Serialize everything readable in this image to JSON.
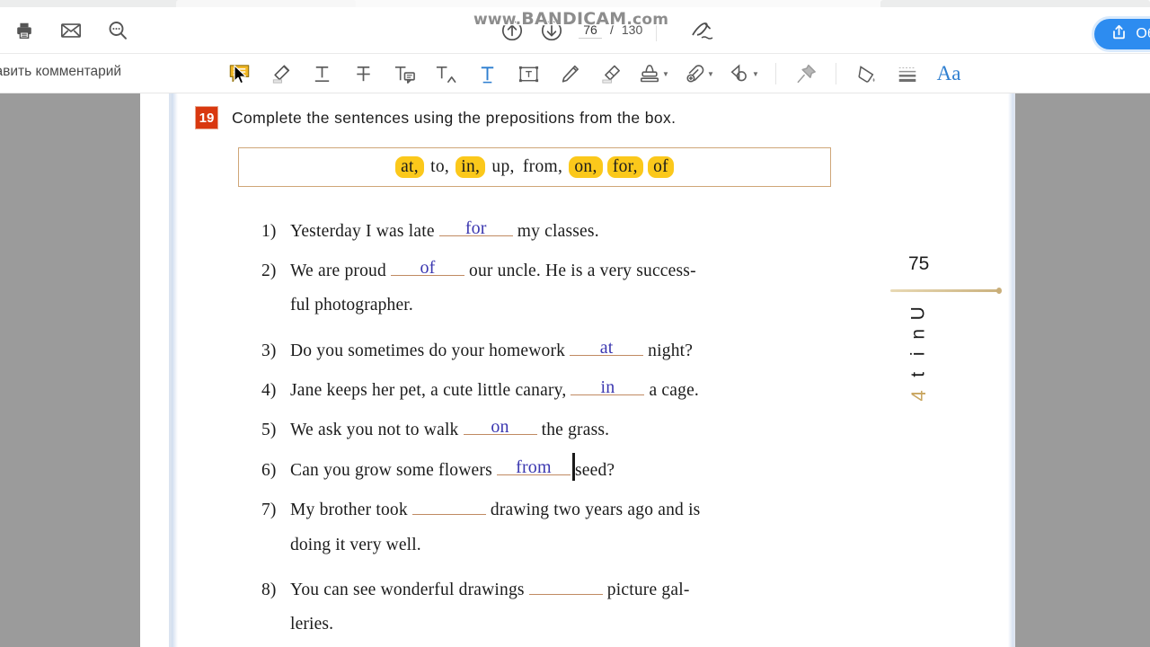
{
  "app": {
    "watermark": "www.BANDICAM.com",
    "watermark_prefix": "www.",
    "watermark_mid": "BANDICAM",
    "watermark_suffix": ".com"
  },
  "toolbar_top": {
    "print_icon": "printer-icon",
    "mail_icon": "envelope-icon",
    "search_icon": "search-comments-icon",
    "prev_page_icon": "arrow-up-circle-icon",
    "next_page_icon": "arrow-down-circle-icon",
    "current_page": "76",
    "page_separator": "/",
    "total_pages": "130",
    "sign_icon": "sign-pen-icon",
    "share_label": "Об",
    "share_icon": "share-upload-icon",
    "share_color": "#2d8cf0"
  },
  "toolbar_tools": {
    "add_comment_label": "бавить комментарий",
    "items": [
      {
        "name": "sticky-note-icon",
        "label": "Заметка"
      },
      {
        "name": "highlighter-icon",
        "label": "Выделение цветом"
      },
      {
        "name": "underline-text-icon",
        "label": "Подчёркивание"
      },
      {
        "name": "strikethrough-text-icon",
        "label": "Зачёркивание"
      },
      {
        "name": "text-comment-icon",
        "label": "Комментарий к тексту"
      },
      {
        "name": "insert-text-icon",
        "label": "Вставка текста"
      },
      {
        "name": "text-tool-icon",
        "label": "Текст"
      },
      {
        "name": "text-box-icon",
        "label": "Текстовое поле"
      },
      {
        "name": "pencil-icon",
        "label": "Карандаш"
      },
      {
        "name": "eraser-icon",
        "label": "Ластик"
      },
      {
        "name": "stamp-icon",
        "label": "Штамп"
      },
      {
        "name": "attachment-icon",
        "label": "Вложение"
      },
      {
        "name": "shapes-icon",
        "label": "Фигуры"
      },
      {
        "name": "pin-icon",
        "label": "Закрепить"
      },
      {
        "name": "fill-color-icon",
        "label": "Заливка"
      },
      {
        "name": "line-style-icon",
        "label": "Толщина линии"
      },
      {
        "name": "font-size-icon",
        "label": "Aa"
      }
    ]
  },
  "document": {
    "exercise_number": "19",
    "exercise_title": "Complete the sentences using the prepositions from the box.",
    "word_box": [
      {
        "text": "at,",
        "highlighted": true
      },
      {
        "text": "to,",
        "highlighted": false
      },
      {
        "text": "in,",
        "highlighted": true
      },
      {
        "text": "up,",
        "highlighted": false
      },
      {
        "text": "from,",
        "highlighted": false
      },
      {
        "text": "on,",
        "highlighted": true
      },
      {
        "text": "for,",
        "highlighted": true
      },
      {
        "text": "of",
        "highlighted": true
      }
    ],
    "sentences": [
      {
        "index": "1)",
        "before": "Yesterday I was late",
        "answer": "for",
        "after": "my classes.",
        "continuation": ""
      },
      {
        "index": "2)",
        "before": "We are proud",
        "answer": "of",
        "after": "our uncle. He is a very success-",
        "continuation": "ful photographer."
      },
      {
        "index": "3)",
        "before": "Do you sometimes do your homework",
        "answer": "at",
        "after": "night?",
        "continuation": ""
      },
      {
        "index": "4)",
        "before": "Jane keeps her pet, a cute little canary,",
        "answer": "in",
        "after": "a cage.",
        "continuation": ""
      },
      {
        "index": "5)",
        "before": "We ask you not to walk",
        "answer": "on",
        "after": "the grass.",
        "continuation": ""
      },
      {
        "index": "6)",
        "before": "Can you grow some flowers",
        "answer": "from",
        "after": "seed?",
        "continuation": "",
        "caret": true
      },
      {
        "index": "7)",
        "before": "My brother took",
        "answer": "",
        "after": "drawing two years ago and is",
        "continuation": "doing it very well."
      },
      {
        "index": "8)",
        "before": "You can see wonderful drawings",
        "answer": "",
        "after": "picture gal-",
        "continuation": "leries."
      }
    ],
    "page_number": "75",
    "unit_word": "Unit",
    "unit_number": "4",
    "answer_color": "#3b37b0",
    "highlight_color": "#fbc81b",
    "badge_color": "#d9380f"
  }
}
